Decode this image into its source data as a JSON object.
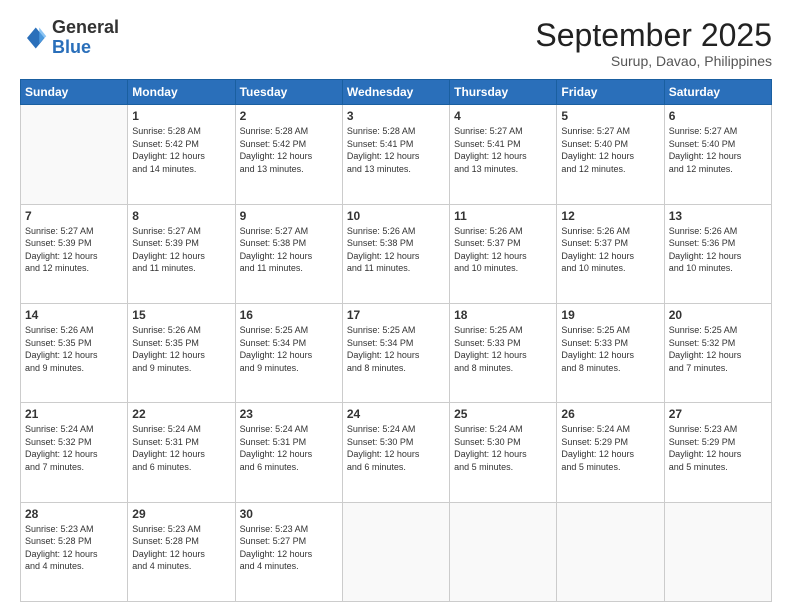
{
  "header": {
    "logo": {
      "line1": "General",
      "line2": "Blue"
    },
    "title": "September 2025",
    "subtitle": "Surup, Davao, Philippines"
  },
  "days_of_week": [
    "Sunday",
    "Monday",
    "Tuesday",
    "Wednesday",
    "Thursday",
    "Friday",
    "Saturday"
  ],
  "weeks": [
    [
      {
        "day": null,
        "info": null
      },
      {
        "day": "1",
        "info": "Sunrise: 5:28 AM\nSunset: 5:42 PM\nDaylight: 12 hours\nand 14 minutes."
      },
      {
        "day": "2",
        "info": "Sunrise: 5:28 AM\nSunset: 5:42 PM\nDaylight: 12 hours\nand 13 minutes."
      },
      {
        "day": "3",
        "info": "Sunrise: 5:28 AM\nSunset: 5:41 PM\nDaylight: 12 hours\nand 13 minutes."
      },
      {
        "day": "4",
        "info": "Sunrise: 5:27 AM\nSunset: 5:41 PM\nDaylight: 12 hours\nand 13 minutes."
      },
      {
        "day": "5",
        "info": "Sunrise: 5:27 AM\nSunset: 5:40 PM\nDaylight: 12 hours\nand 12 minutes."
      },
      {
        "day": "6",
        "info": "Sunrise: 5:27 AM\nSunset: 5:40 PM\nDaylight: 12 hours\nand 12 minutes."
      }
    ],
    [
      {
        "day": "7",
        "info": "Sunrise: 5:27 AM\nSunset: 5:39 PM\nDaylight: 12 hours\nand 12 minutes."
      },
      {
        "day": "8",
        "info": "Sunrise: 5:27 AM\nSunset: 5:39 PM\nDaylight: 12 hours\nand 11 minutes."
      },
      {
        "day": "9",
        "info": "Sunrise: 5:27 AM\nSunset: 5:38 PM\nDaylight: 12 hours\nand 11 minutes."
      },
      {
        "day": "10",
        "info": "Sunrise: 5:26 AM\nSunset: 5:38 PM\nDaylight: 12 hours\nand 11 minutes."
      },
      {
        "day": "11",
        "info": "Sunrise: 5:26 AM\nSunset: 5:37 PM\nDaylight: 12 hours\nand 10 minutes."
      },
      {
        "day": "12",
        "info": "Sunrise: 5:26 AM\nSunset: 5:37 PM\nDaylight: 12 hours\nand 10 minutes."
      },
      {
        "day": "13",
        "info": "Sunrise: 5:26 AM\nSunset: 5:36 PM\nDaylight: 12 hours\nand 10 minutes."
      }
    ],
    [
      {
        "day": "14",
        "info": "Sunrise: 5:26 AM\nSunset: 5:35 PM\nDaylight: 12 hours\nand 9 minutes."
      },
      {
        "day": "15",
        "info": "Sunrise: 5:26 AM\nSunset: 5:35 PM\nDaylight: 12 hours\nand 9 minutes."
      },
      {
        "day": "16",
        "info": "Sunrise: 5:25 AM\nSunset: 5:34 PM\nDaylight: 12 hours\nand 9 minutes."
      },
      {
        "day": "17",
        "info": "Sunrise: 5:25 AM\nSunset: 5:34 PM\nDaylight: 12 hours\nand 8 minutes."
      },
      {
        "day": "18",
        "info": "Sunrise: 5:25 AM\nSunset: 5:33 PM\nDaylight: 12 hours\nand 8 minutes."
      },
      {
        "day": "19",
        "info": "Sunrise: 5:25 AM\nSunset: 5:33 PM\nDaylight: 12 hours\nand 8 minutes."
      },
      {
        "day": "20",
        "info": "Sunrise: 5:25 AM\nSunset: 5:32 PM\nDaylight: 12 hours\nand 7 minutes."
      }
    ],
    [
      {
        "day": "21",
        "info": "Sunrise: 5:24 AM\nSunset: 5:32 PM\nDaylight: 12 hours\nand 7 minutes."
      },
      {
        "day": "22",
        "info": "Sunrise: 5:24 AM\nSunset: 5:31 PM\nDaylight: 12 hours\nand 6 minutes."
      },
      {
        "day": "23",
        "info": "Sunrise: 5:24 AM\nSunset: 5:31 PM\nDaylight: 12 hours\nand 6 minutes."
      },
      {
        "day": "24",
        "info": "Sunrise: 5:24 AM\nSunset: 5:30 PM\nDaylight: 12 hours\nand 6 minutes."
      },
      {
        "day": "25",
        "info": "Sunrise: 5:24 AM\nSunset: 5:30 PM\nDaylight: 12 hours\nand 5 minutes."
      },
      {
        "day": "26",
        "info": "Sunrise: 5:24 AM\nSunset: 5:29 PM\nDaylight: 12 hours\nand 5 minutes."
      },
      {
        "day": "27",
        "info": "Sunrise: 5:23 AM\nSunset: 5:29 PM\nDaylight: 12 hours\nand 5 minutes."
      }
    ],
    [
      {
        "day": "28",
        "info": "Sunrise: 5:23 AM\nSunset: 5:28 PM\nDaylight: 12 hours\nand 4 minutes."
      },
      {
        "day": "29",
        "info": "Sunrise: 5:23 AM\nSunset: 5:28 PM\nDaylight: 12 hours\nand 4 minutes."
      },
      {
        "day": "30",
        "info": "Sunrise: 5:23 AM\nSunset: 5:27 PM\nDaylight: 12 hours\nand 4 minutes."
      },
      {
        "day": null,
        "info": null
      },
      {
        "day": null,
        "info": null
      },
      {
        "day": null,
        "info": null
      },
      {
        "day": null,
        "info": null
      }
    ]
  ]
}
